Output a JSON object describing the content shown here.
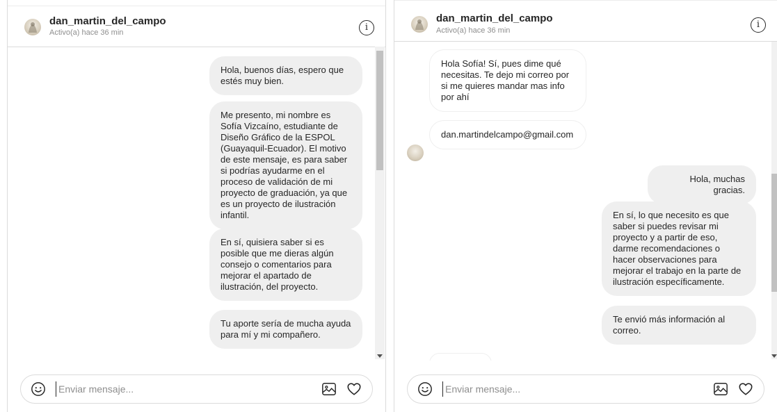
{
  "left_panel": {
    "header": {
      "username": "dan_martin_del_campo",
      "status": "Activo(a) hace 36 min"
    },
    "messages": [
      {
        "text": "Hola, buenos días, espero que estés muy bien."
      },
      {
        "text": "Me presento, mi nombre es Sofía Vizcaíno, estudiante de Diseño Gráfico de la ESPOL (Guayaquil-Ecuador). El motivo de este mensaje, es para saber si podrías ayudarme en el proceso de validación de mi proyecto de graduación, ya que es un proyecto de ilustración infantil."
      },
      {
        "text": "En sí, quisiera saber si es posible que me dieras algún consejo o comentarios para mejorar el apartado de ilustración, del proyecto."
      },
      {
        "text": "Tu aporte sería de mucha ayuda para mí y mi compañero."
      }
    ],
    "composer": {
      "placeholder": "Enviar mensaje..."
    }
  },
  "right_panel": {
    "header": {
      "username": "dan_martin_del_campo",
      "status": "Activo(a) hace 36 min"
    },
    "messages": [
      {
        "text": "Hola Sofía! Sí, pues dime qué necesitas. Te dejo mi correo por si me quieres mandar mas info por ahí"
      },
      {
        "text": "dan.martindelcampo@gmail.com"
      },
      {
        "text": "Hola, muchas gracias."
      },
      {
        "text": "En sí, lo que necesito es que saber si puedes revisar mi proyecto y a partir de eso, darme recomendaciones o hacer observaciones para mejorar el trabajo en la parte de ilustración específicamente."
      },
      {
        "text": "Te envió más información al correo."
      }
    ],
    "composer": {
      "placeholder": "Enviar mensaje..."
    }
  },
  "icons": {
    "info": "info-icon",
    "emoji": "emoji-icon",
    "image": "image-icon",
    "heart": "heart-icon"
  },
  "colors": {
    "bubble": "#efefef",
    "border": "#dbdbdb",
    "muted": "#8e8e8e",
    "text": "#262626"
  }
}
